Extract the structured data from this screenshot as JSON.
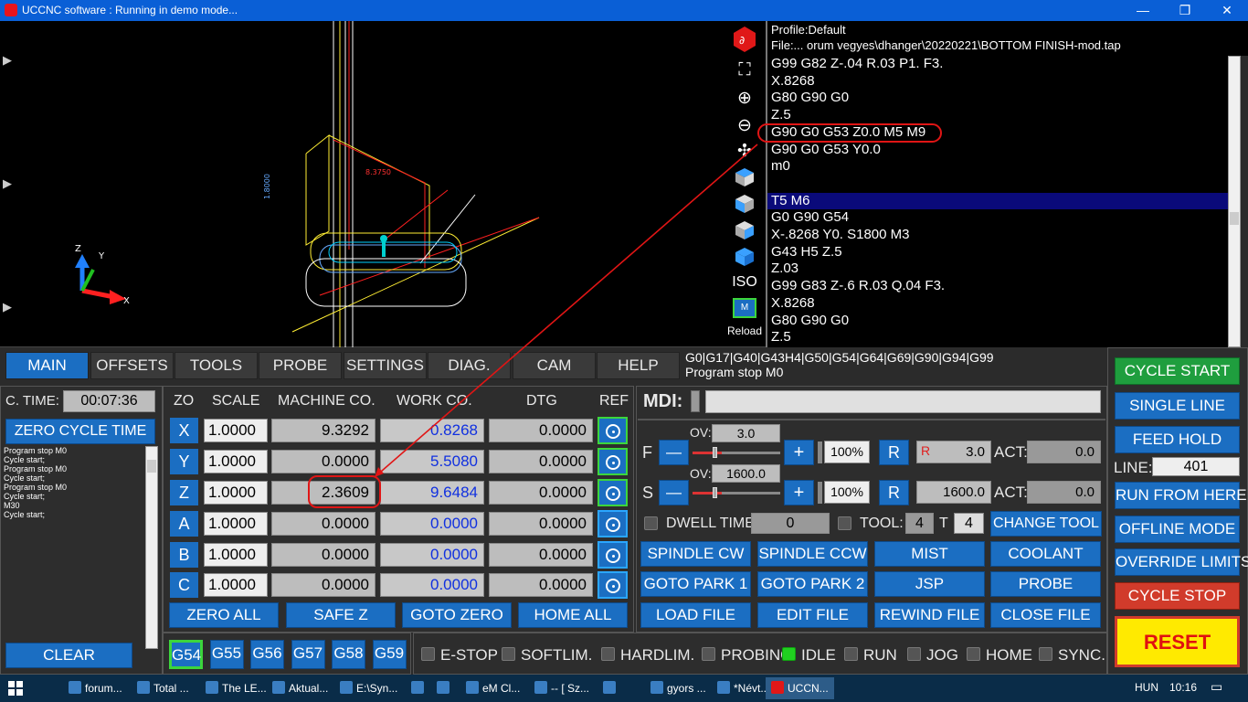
{
  "window": {
    "title": "UCCNC software : Running in demo mode...",
    "minimize": "—",
    "maximize": "❐",
    "close": "✕"
  },
  "viewport": {
    "dim_label_1": "8.3750",
    "dim_label_2": "1.8000"
  },
  "viewbar": {
    "iso_label": "ISO",
    "reload_label": "Reload",
    "icons": [
      "uccnc-logo-icon",
      "fit-icon",
      "zoom-in-icon",
      "zoom-out-icon",
      "fit-all-icon",
      "view-top-icon",
      "view-front-icon",
      "view-side-icon",
      "view-iso-icon"
    ]
  },
  "file": {
    "profile": "Profile:Default",
    "path": "File:... orum vegyes\\dhanger\\20220221\\BOTTOM FINISH-mod.tap"
  },
  "gcode": {
    "lines": [
      "G99 G82 Z-.04 R.03 P1. F3.",
      "X.8268",
      "G80 G90 G0",
      "Z.5",
      "G90 G0 G53 Z0.0 M5 M9",
      "G90 G0 G53 Y0.0",
      "m0",
      "",
      "T5 M6",
      "G0 G90 G54",
      "X-.8268 Y0. S1800 M3",
      "G43 H5 Z.5",
      "Z.03",
      "G99 G83 Z-.6 R.03 Q.04 F3.",
      "X.8268",
      "G80 G90 G0",
      "Z.5"
    ],
    "selected_index": 8
  },
  "tabs": [
    "MAIN",
    "OFFSETS",
    "TOOLS",
    "PROBE",
    "SETTINGS",
    "DIAG.",
    "CAM",
    "HELP"
  ],
  "modal_line1": "G0|G17|G40|G43H4|G50|G54|G64|G69|G90|G94|G99",
  "modal_line2": "Program stop M0",
  "ctime": {
    "label": "C. TIME:",
    "value": "00:07:36"
  },
  "zero_cycle_time": "ZERO CYCLE TIME",
  "status_log": [
    "Program stop M0",
    "Cycle start;",
    "Program stop M0",
    "Cycle start;",
    "Program stop M0",
    "Cycle start;",
    "M30",
    "Cycle start;"
  ],
  "clear": "CLEAR",
  "dro_headers": {
    "zo": "ZO",
    "scale": "SCALE",
    "machine": "MACHINE CO.",
    "work": "WORK CO.",
    "dtg": "DTG",
    "ref": "REF"
  },
  "axes": [
    {
      "name": "X",
      "scale": "1.0000",
      "machine": "9.3292",
      "work": "0.8268",
      "dtg": "0.0000",
      "ref_on": true
    },
    {
      "name": "Y",
      "scale": "1.0000",
      "machine": "0.0000",
      "work": "5.5080",
      "dtg": "0.0000",
      "ref_on": true
    },
    {
      "name": "Z",
      "scale": "1.0000",
      "machine": "2.3609",
      "work": "9.6484",
      "dtg": "0.0000",
      "ref_on": true
    },
    {
      "name": "A",
      "scale": "1.0000",
      "machine": "0.0000",
      "work": "0.0000",
      "dtg": "0.0000",
      "ref_on": false
    },
    {
      "name": "B",
      "scale": "1.0000",
      "machine": "0.0000",
      "work": "0.0000",
      "dtg": "0.0000",
      "ref_on": false
    },
    {
      "name": "C",
      "scale": "1.0000",
      "machine": "0.0000",
      "work": "0.0000",
      "dtg": "0.0000",
      "ref_on": false
    }
  ],
  "dro_buttons": [
    "ZERO ALL",
    "SAFE Z",
    "GOTO ZERO",
    "HOME ALL"
  ],
  "work_offsets": [
    "G54",
    "G55",
    "G56",
    "G57",
    "G58",
    "G59"
  ],
  "active_offset": "G54",
  "mdi": {
    "label": "MDI:",
    "value": ""
  },
  "feed": {
    "letter": "F",
    "ov_label": "OV:",
    "ov_value": "3.0",
    "percent": "100%",
    "reset": "R",
    "r_letter": "R",
    "set_value": "3.0",
    "act_label": "ACT:",
    "act_value": "0.0",
    "override_fraction": 0.25
  },
  "spindle": {
    "letter": "S",
    "ov_label": "OV:",
    "ov_value": "1600.0",
    "percent": "100%",
    "reset": "R",
    "set_value": "1600.0",
    "act_label": "ACT:",
    "act_value": "0.0",
    "override_fraction": 0.25
  },
  "minus": "—",
  "plus": "+",
  "dwell": {
    "label": "DWELL TIME:",
    "value": "0"
  },
  "tool": {
    "label": "TOOL:",
    "current": "4",
    "t_label": "T",
    "next": "4",
    "change": "CHANGE TOOL"
  },
  "func_buttons": [
    "SPINDLE CW",
    "SPINDLE CCW",
    "MIST",
    "COOLANT",
    "GOTO PARK 1",
    "GOTO PARK 2",
    "JSP",
    "PROBE",
    "LOAD FILE",
    "EDIT FILE",
    "REWIND FILE",
    "CLOSE FILE"
  ],
  "status_leds": [
    {
      "label": "E-STOP",
      "on": false
    },
    {
      "label": "SOFTLIM.",
      "on": false
    },
    {
      "label": "HARDLIM.",
      "on": false
    },
    {
      "label": "PROBING",
      "on": false
    },
    {
      "label": "IDLE",
      "on": true
    },
    {
      "label": "RUN",
      "on": false
    },
    {
      "label": "JOG",
      "on": false
    },
    {
      "label": "HOME",
      "on": false
    },
    {
      "label": "SYNC.",
      "on": false
    }
  ],
  "right": {
    "cycle_start": "CYCLE START",
    "single_line": "SINGLE LINE",
    "feed_hold": "FEED HOLD",
    "line_label": "LINE:",
    "line_value": "401",
    "run_from_here": "RUN FROM HERE",
    "offline_mode": "OFFLINE MODE",
    "override_limits": "OVERRIDE LIMITS",
    "cycle_stop": "CYCLE STOP",
    "reset": "RESET"
  },
  "taskbar": {
    "items": [
      "forum...",
      "Total ...",
      "The LE...",
      "Aktual...",
      "E:\\Syn...",
      "",
      "",
      "eM Cl...",
      "-- [ Sz...",
      "",
      "gyors ...",
      "*Névt...",
      "UCCN..."
    ],
    "lang": "HUN",
    "time": "10:16"
  },
  "colors": {
    "accent": "#1b6ec2",
    "active_tab": "#1b6ec2",
    "cycle_start": "#1f9e3e",
    "cycle_stop": "#d13b2b",
    "reset_bg": "#ffea00",
    "reset_text": "#e01010",
    "annotation": "#e01515"
  }
}
